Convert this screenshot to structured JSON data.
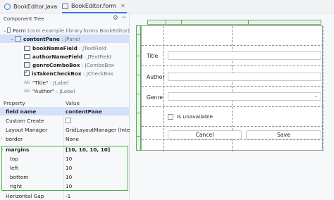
{
  "tabs": [
    {
      "label": "BookEditor.java",
      "icon": "java-class-icon",
      "active": false
    },
    {
      "label": "BookEditor.form",
      "icon": "form-file-icon",
      "active": true
    }
  ],
  "component_tree": {
    "title": "Component Tree",
    "rows": [
      {
        "name": "Form",
        "type": "(com.example.library.forms.BookEditor)"
      },
      {
        "name": "contentPane",
        "type": ": JPanel"
      },
      {
        "name": "bookNameField",
        "type": ": JTextField"
      },
      {
        "name": "authorNameField",
        "type": ": JTextField"
      },
      {
        "name": "genreComboBox",
        "type": ": JComboBox"
      },
      {
        "name": "isTakenCheckBox",
        "type": ": JCheckBox"
      },
      {
        "name": "\"Title\"",
        "type": ": JLabel"
      },
      {
        "name": "\"Author\"",
        "type": ": JLabel"
      }
    ]
  },
  "properties": {
    "header_property": "Property",
    "header_value": "Value",
    "rows": [
      {
        "key": "field name",
        "value": "contentPane"
      },
      {
        "key": "Custom Create",
        "value": ""
      },
      {
        "key": "Layout Manager",
        "value": "GridLayoutManager (Inte..."
      },
      {
        "key": "border",
        "value": "None"
      },
      {
        "key": "margins",
        "value": "[10, 10, 10, 10]"
      },
      {
        "key": "top",
        "value": "10"
      },
      {
        "key": "left",
        "value": "10"
      },
      {
        "key": "bottom",
        "value": "10"
      },
      {
        "key": "right",
        "value": "10"
      },
      {
        "key": "Horizontal Gap",
        "value": "-1"
      }
    ]
  },
  "form": {
    "title_label": "Title",
    "author_label": "Author",
    "genre_label": "Genre",
    "checkbox_label": "Is unavailable",
    "cancel_label": "Cancel",
    "save_label": "Save"
  },
  "colors": {
    "selection": "#d5e1f8",
    "accent": "#3574f0",
    "margin_highlight": "#4cae4c"
  }
}
